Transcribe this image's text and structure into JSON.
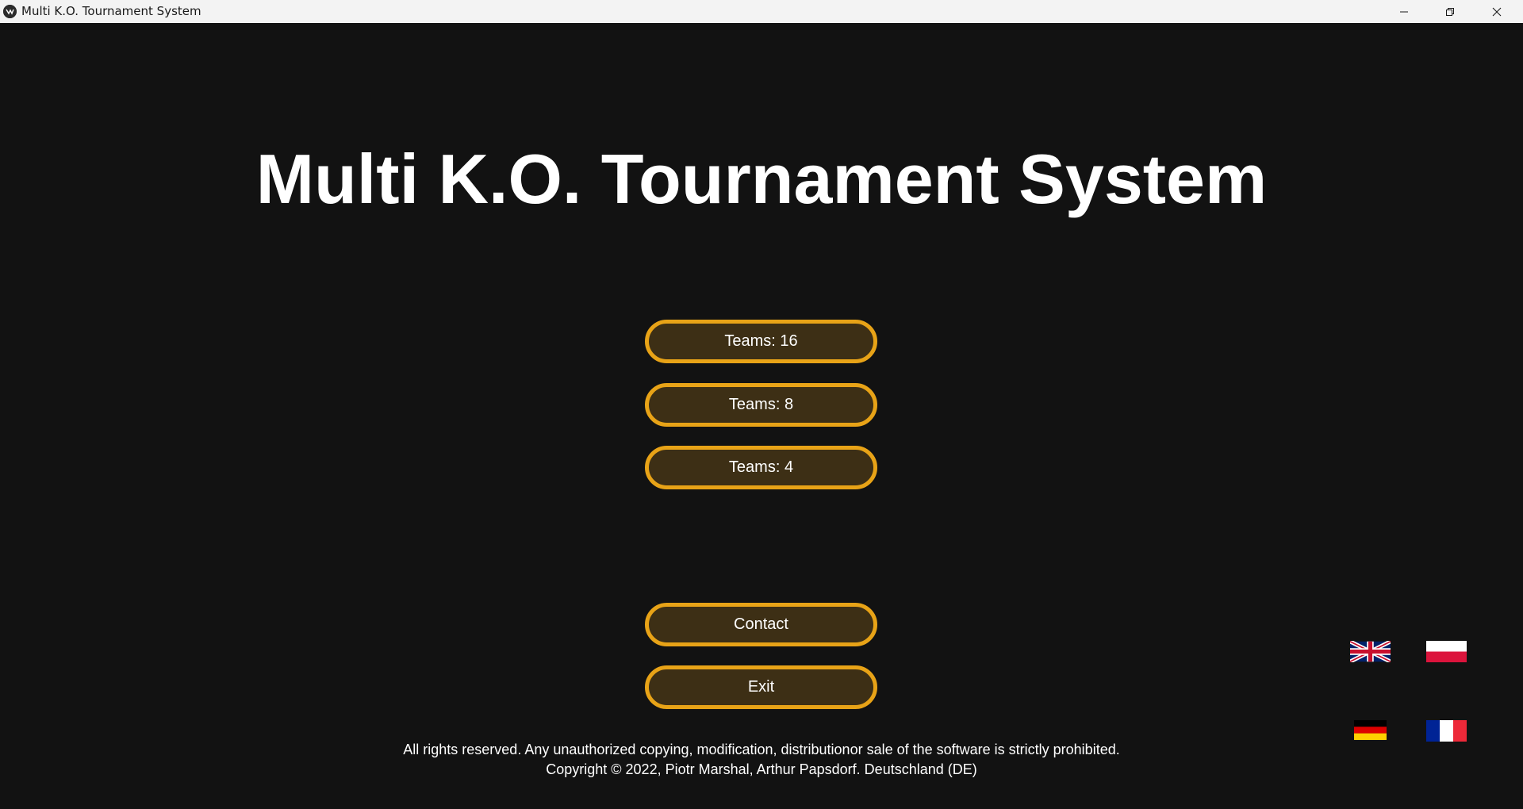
{
  "window": {
    "title": "Multi K.O. Tournament System",
    "app_icon": "kivy-logo-icon",
    "controls": [
      "minimize-icon",
      "restore-icon",
      "close-icon"
    ]
  },
  "main": {
    "title": "Multi K.O. Tournament System",
    "team_buttons": [
      {
        "label": "Teams: 16"
      },
      {
        "label": "Teams: 8"
      },
      {
        "label": "Teams: 4"
      }
    ],
    "contact_label": "Contact",
    "exit_label": "Exit"
  },
  "footer": {
    "line1": "All rights reserved. Any unauthorized copying, modification, distributionor sale of the software is strictly prohibited.",
    "line2": "Copyright © 2022, Piotr Marshal, Arthur Papsdorf. Deutschland (DE)"
  },
  "languages": [
    {
      "flag": "uk-flag-icon"
    },
    {
      "flag": "poland-flag-icon"
    },
    {
      "flag": "germany-flag-icon"
    },
    {
      "flag": "france-flag-icon"
    }
  ],
  "colors": {
    "background": "#121212",
    "button_fill": "#3d2f15",
    "button_border": "#e8a317",
    "text": "#ffffff",
    "titlebar": "#f3f3f3"
  }
}
